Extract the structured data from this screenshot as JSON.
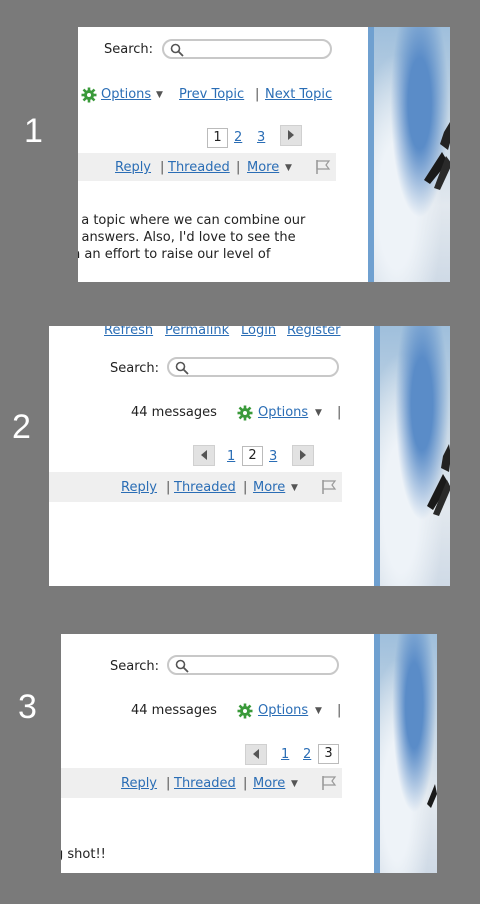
{
  "labels": [
    "1",
    "2",
    "3"
  ],
  "search": {
    "label": "Search:"
  },
  "nav": {
    "options": "Options",
    "prev_topic": "Prev Topic",
    "next_topic": "Next Topic",
    "refresh": "Refresh",
    "permalink": "Permalink",
    "login": "Login",
    "register": "Register",
    "sep": "|"
  },
  "messages_count": "44 messages",
  "pages": [
    "1",
    "2",
    "3"
  ],
  "toolbar": {
    "reply": "Reply",
    "threaded": "Threaded",
    "more": "More",
    "sep": "|"
  },
  "frame1_body": [
    "t a topic where we can combine our",
    "r answers.  Also, I'd love to see the",
    "n an effort to raise our level of"
  ],
  "frame3_body": "g shot!!",
  "colors": {
    "link": "#2a6db5",
    "gear": "#3a9a3a",
    "toolbar_bg": "#efefef",
    "side_bar": "#6fa0d0"
  },
  "icons": [
    "search-icon",
    "gear-icon",
    "chevron-down-icon",
    "arrow-left-icon",
    "arrow-right-icon",
    "flag-icon"
  ]
}
